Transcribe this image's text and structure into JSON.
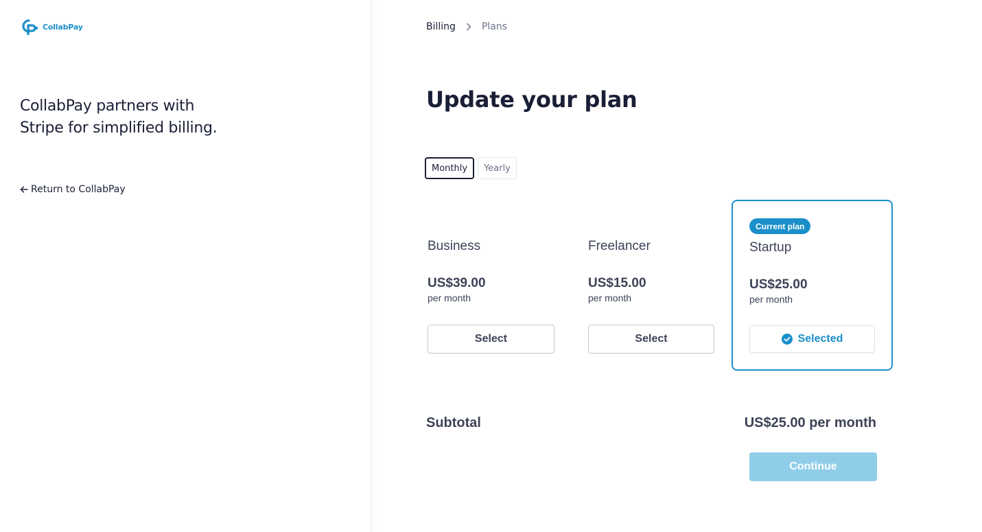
{
  "brand": {
    "logo_text": "CollabPay",
    "accent_color": "#1b8fc9",
    "logo_icon": "collabpay-logo-icon"
  },
  "sidebar": {
    "tagline": "CollabPay partners with Stripe for simplified billing.",
    "return_label": "Return to CollabPay",
    "return_icon": "arrow-left-icon"
  },
  "breadcrumb": {
    "items": [
      "Billing",
      "Plans"
    ],
    "separator_icon": "chevron-right-icon"
  },
  "page": {
    "title": "Update your plan"
  },
  "billing_toggle": {
    "options": [
      "Monthly",
      "Yearly"
    ],
    "selected": "Monthly"
  },
  "plans": [
    {
      "name": "Business",
      "price": "US$39.00",
      "period": "per month",
      "button_label": "Select",
      "current": false
    },
    {
      "name": "Freelancer",
      "price": "US$15.00",
      "period": "per month",
      "button_label": "Select",
      "current": false
    },
    {
      "name": "Startup",
      "price": "US$25.00",
      "period": "per month",
      "button_label": "Selected",
      "current": true,
      "badge": "Current plan",
      "button_icon": "check-circle-icon"
    }
  ],
  "summary": {
    "subtotal_label": "Subtotal",
    "subtotal_value": "US$25.00 per month",
    "continue_label": "Continue",
    "continue_color": "#90cde8"
  }
}
